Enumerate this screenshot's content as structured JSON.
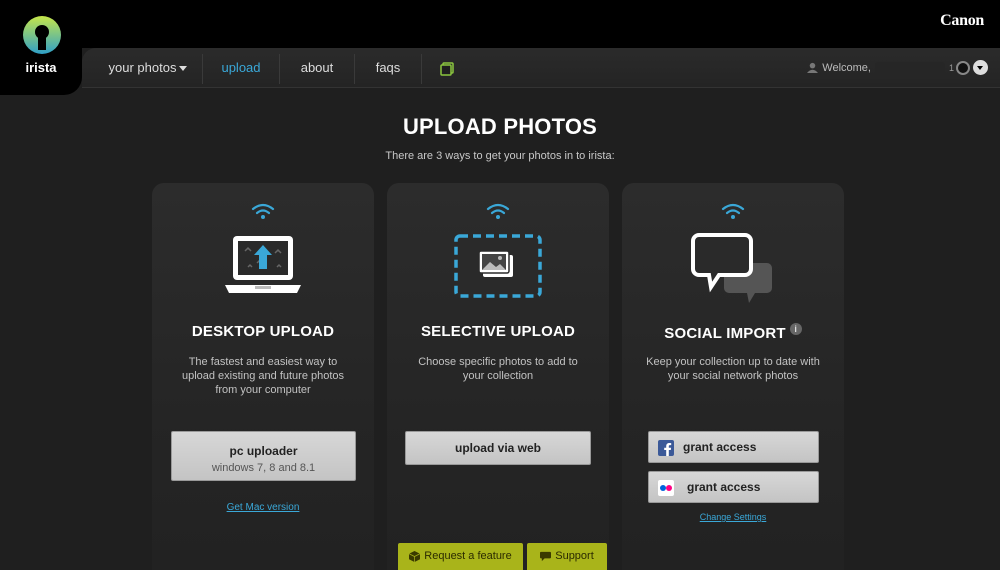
{
  "brand": {
    "name": "irista",
    "partner": "Canon"
  },
  "nav": {
    "items": [
      {
        "label": "your photos",
        "active": false,
        "dropdown": true
      },
      {
        "label": "upload",
        "active": true
      },
      {
        "label": "about",
        "active": false
      },
      {
        "label": "faqs",
        "active": false
      }
    ],
    "extra_icon": "app-square-icon",
    "welcome_label": "Welcome,",
    "tiny_num": "1"
  },
  "page": {
    "title": "UPLOAD PHOTOS",
    "subtitle": "There are 3 ways to get your photos in to irista:"
  },
  "cards": [
    {
      "title": "DESKTOP UPLOAD",
      "description": "The fastest and easiest way to upload existing and future photos from your computer",
      "button_label": "pc uploader",
      "button_sub": "windows 7, 8 and 8.1",
      "link": "Get Mac version"
    },
    {
      "title": "SELECTIVE UPLOAD",
      "description": "Choose specific photos to add to your collection",
      "button_label": "upload via web"
    },
    {
      "title": "SOCIAL IMPORT",
      "info": "i",
      "description": "Keep your collection up to date with your social network photos",
      "facebook_label": "grant access",
      "flickr_label": "grant access",
      "link": "Change Settings"
    }
  ],
  "footer": {
    "request_label": "Request a feature",
    "support_label": "Support"
  },
  "colors": {
    "accent": "#3aa8d8",
    "footer_btn": "#a9b41a",
    "logo_green": "#9fd23a"
  }
}
